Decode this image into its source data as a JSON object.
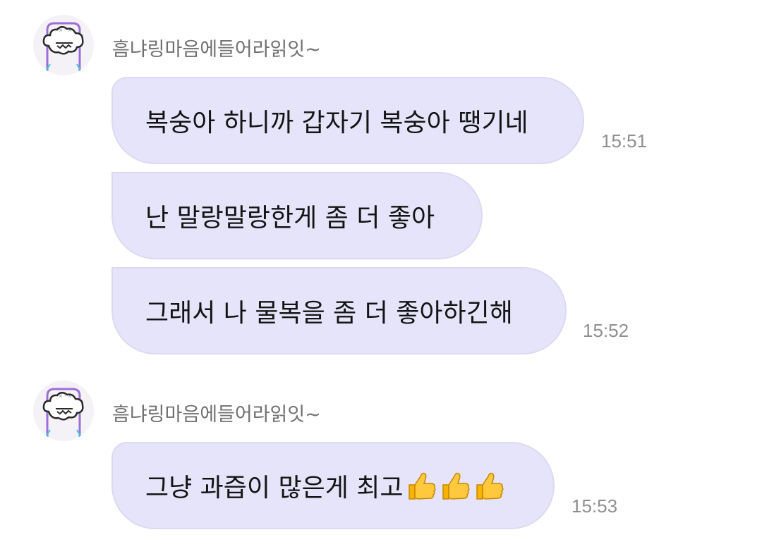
{
  "groups": [
    {
      "sender": "흠냐링마음에들어라읽잇~",
      "messages": [
        {
          "text": "복숭아 하니까 갑자기 복숭아 땡기네",
          "time": "15:51"
        },
        {
          "text": "난 말랑말랑한게 좀 더 좋아",
          "time": ""
        },
        {
          "text": "그래서 나 물복을 좀 더 좋아하긴해",
          "time": "15:52"
        }
      ]
    },
    {
      "sender": "흠냐링마음에들어라읽잇~",
      "messages": [
        {
          "text": "그냥 과즙이 많은게 최고",
          "emoji": "thumbs-up x3",
          "time": "15:53"
        }
      ]
    }
  ],
  "colors": {
    "bubble": "#e6e4fa",
    "bubble_border": "#dcd9f1",
    "sender_text": "#707070",
    "time_text": "#8f8f8f",
    "avatar_accent": "#8a56c9"
  }
}
